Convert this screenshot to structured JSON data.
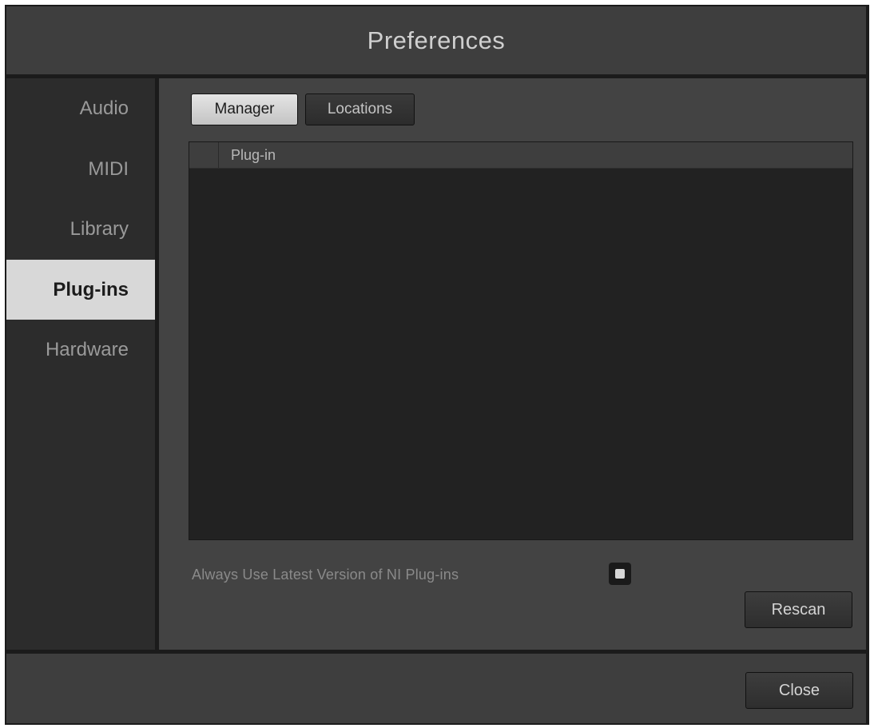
{
  "window": {
    "title": "Preferences"
  },
  "sidebar": {
    "items": [
      {
        "label": "Audio",
        "active": false
      },
      {
        "label": "MIDI",
        "active": false
      },
      {
        "label": "Library",
        "active": false
      },
      {
        "label": "Plug-ins",
        "active": true
      },
      {
        "label": "Hardware",
        "active": false
      }
    ]
  },
  "tabs": {
    "manager_label": "Manager",
    "locations_label": "Locations",
    "selected": "Manager"
  },
  "plugin_list": {
    "columns": [
      "",
      "Plug-in"
    ],
    "rows": []
  },
  "options": {
    "always_latest_label": "Always Use Latest Version of NI Plug-ins",
    "always_latest_checked": false
  },
  "buttons": {
    "rescan_label": "Rescan",
    "close_label": "Close"
  },
  "colors": {
    "active_item_bg": "#d8d8d8",
    "panel_bg": "#434343",
    "list_bg": "#222222"
  }
}
